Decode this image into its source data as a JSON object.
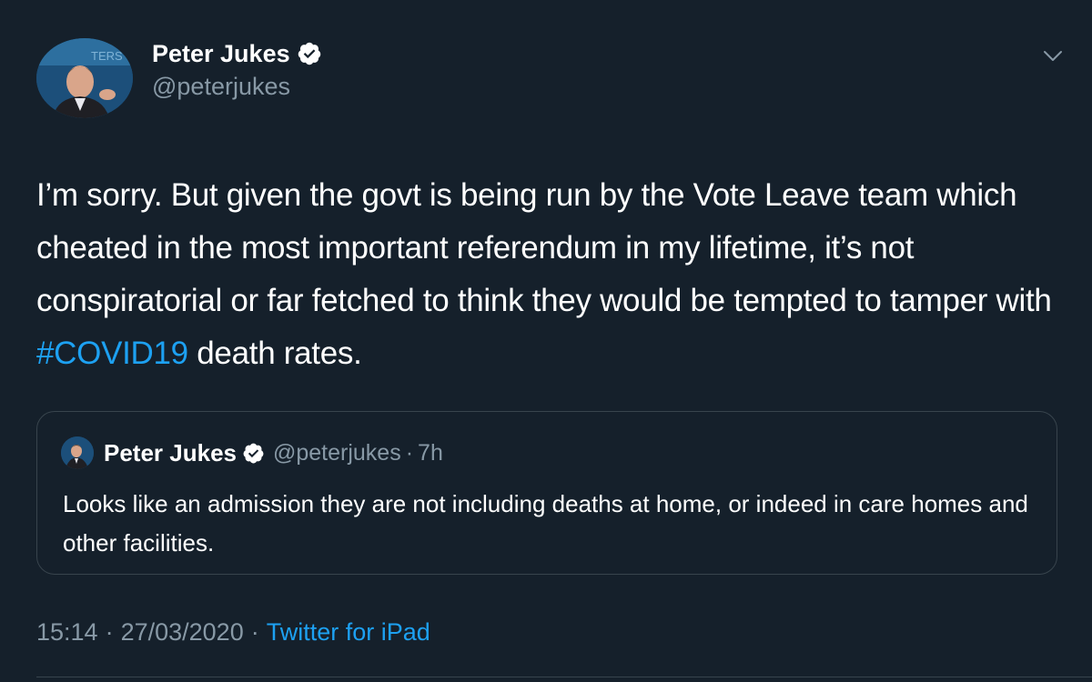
{
  "tweet": {
    "author": {
      "name": "Peter Jukes",
      "handle": "@peterjukes",
      "verified_icon": "verified-badge-icon"
    },
    "menu_icon": "chevron-down-icon",
    "text": {
      "before_hashtag": "I’m sorry. But given the govt is being run by the Vote Leave team which cheated in the most important referendum in my lifetime, it’s not conspiratorial or far fetched to think they would be tempted to tamper with ",
      "hashtag": "#COVID19",
      "after_hashtag": " death rates."
    },
    "quoted_tweet": {
      "author_name": "Peter Jukes",
      "author_handle": "@peterjukes",
      "separator": "·",
      "time_ago": "7h",
      "text": "Looks like an admission they are not including deaths at home, or indeed in care homes and other facilities."
    },
    "meta": {
      "time": "15:14",
      "separator": "·",
      "date": "27/03/2020",
      "source": "Twitter for iPad"
    }
  },
  "colors": {
    "background": "#15202b",
    "text": "#ffffff",
    "secondary_text": "#8899a6",
    "link": "#1da1f2",
    "border": "#38444d"
  }
}
